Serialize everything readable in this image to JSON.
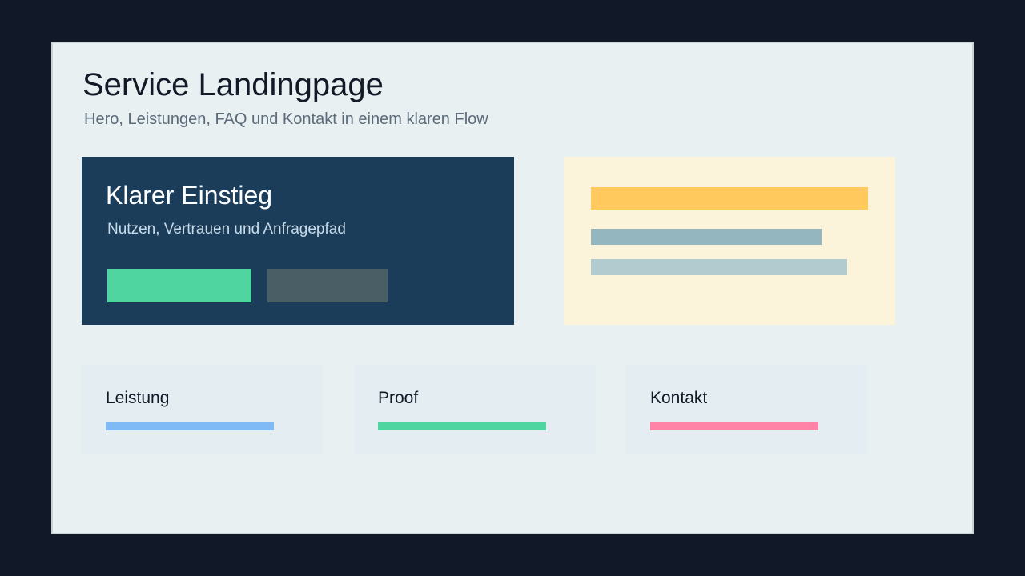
{
  "header": {
    "title": "Service Landingpage",
    "subtitle": "Hero, Leistungen, FAQ und Kontakt in einem klaren Flow"
  },
  "hero": {
    "title": "Klarer Einstieg",
    "subtitle": "Nutzen, Vertrauen und Anfragepfad",
    "primary_color": "#4fd6a0",
    "secondary_color": "#4a5e66",
    "background": "#1b3d5a"
  },
  "preview": {
    "background": "#fbf3da",
    "bar_colors": [
      "#ffc95d",
      "#93b6bf",
      "#b2cbcf"
    ]
  },
  "cards": [
    {
      "label": "Leistung",
      "accent": "#7fbaf6"
    },
    {
      "label": "Proof",
      "accent": "#4fd6a0"
    },
    {
      "label": "Kontakt",
      "accent": "#ff82a7"
    }
  ]
}
